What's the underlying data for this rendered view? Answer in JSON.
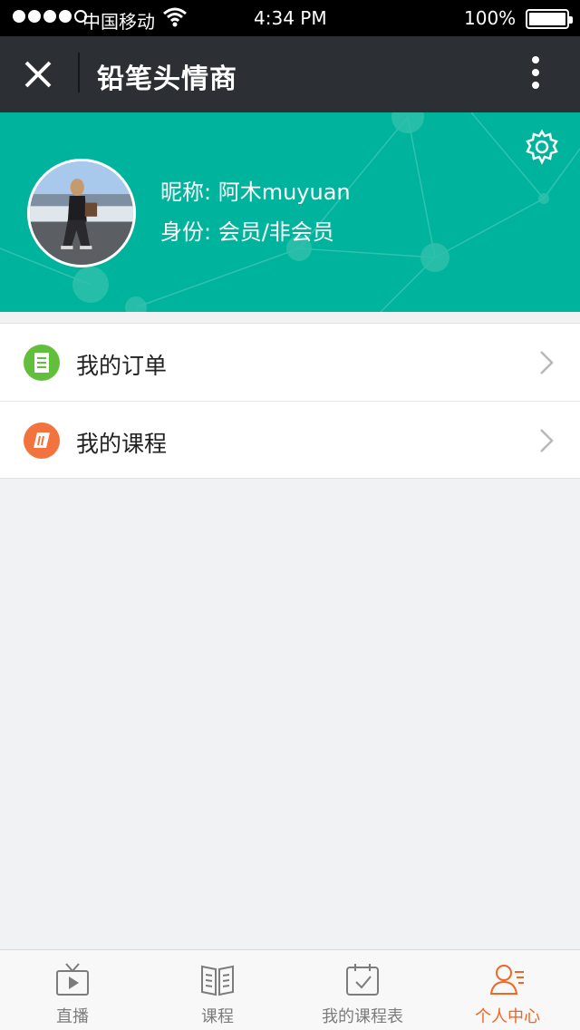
{
  "status_bar": {
    "carrier": "中国移动",
    "time": "4:34 PM",
    "battery": "100%"
  },
  "nav": {
    "title": "铅笔头情商"
  },
  "profile": {
    "nickname": "昵称: 阿木muyuan",
    "identity": "身份: 会员/非会员",
    "accent_color": "#00b39c"
  },
  "menu": {
    "items": [
      {
        "label": "我的订单",
        "icon": "document-icon",
        "color": "#62bf3c"
      },
      {
        "label": "我的课程",
        "icon": "book-icon",
        "color": "#f2733d"
      }
    ]
  },
  "tabs": {
    "items": [
      {
        "label": "直播",
        "icon": "tv-play-icon"
      },
      {
        "label": "课程",
        "icon": "open-book-icon"
      },
      {
        "label": "我的课程表",
        "icon": "calendar-check-icon"
      },
      {
        "label": "个人中心",
        "icon": "user-icon"
      }
    ],
    "active_color": "#f26522"
  }
}
